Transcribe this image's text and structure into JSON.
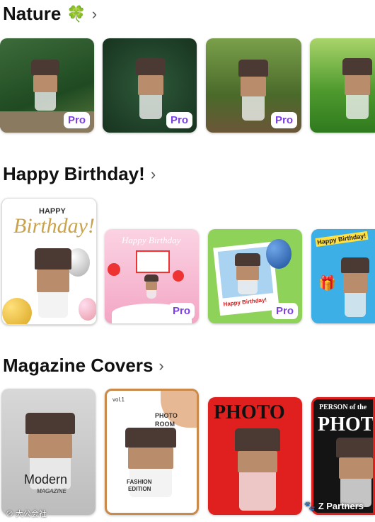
{
  "sections": {
    "nature": {
      "title": "Nature",
      "emoji": "🍀",
      "chevron": "›"
    },
    "birthday": {
      "title": "Happy Birthday!",
      "chevron": "›"
    },
    "magazine": {
      "title": "Magazine Covers",
      "chevron": "›"
    }
  },
  "badges": {
    "pro": "Pro"
  },
  "birthday_cards": {
    "card1_happy": "HAPPY",
    "card1_birthday": "Birthday!",
    "card2_text": "Happy Birthday",
    "card3_banner": "Happy Birthday!",
    "card4_text": "Happy Birthday!"
  },
  "magazine_cards": {
    "card1_title": "Modern",
    "card1_sub": "MAGAZINE",
    "card2_vol": "vol.1",
    "card2_photo": "PHOTO",
    "card2_room": "ROOM",
    "card2_fashion": "FASHION",
    "card2_edition": "EDITION",
    "card3_title": "PHOTO",
    "card4_top": "PERSON of the",
    "card4_title": "PHOT"
  },
  "watermarks": {
    "left": "⊘ 大公会社",
    "right": "🐾 Z Partners"
  },
  "colors": {
    "pro_badge": "#7b3fe4",
    "lid": "#4b3a33",
    "sleeve": "#b98c6c"
  }
}
